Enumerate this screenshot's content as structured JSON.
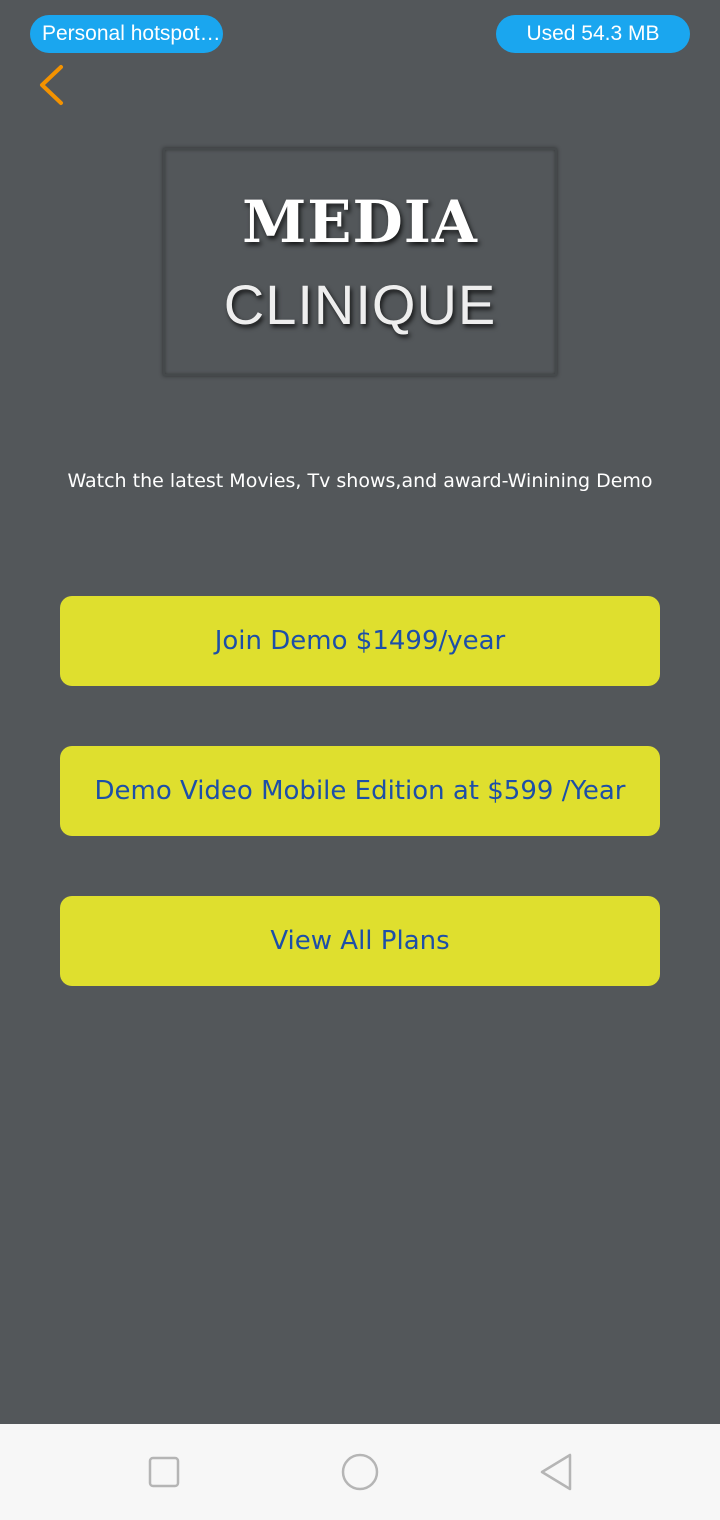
{
  "status_bar": {
    "hotspot_label": "Personal hotspot…",
    "data_used_label": "Used  54.3 MB"
  },
  "header": {
    "back_icon": "chevron-left-icon",
    "back_color": "#f39200"
  },
  "logo": {
    "line1": "MEDIA",
    "line2": "CLINIQUE"
  },
  "tagline": "Watch the latest Movies, Tv shows,and award-Winining Demo",
  "actions": {
    "join": "Join Demo $1499/year",
    "mobile": "Demo Video Mobile Edition at $599 /Year",
    "plans": "View All Plans"
  },
  "nav_bar": {
    "recent_icon": "square-icon",
    "home_icon": "circle-icon",
    "back_icon": "triangle-back-icon"
  },
  "colors": {
    "background": "#53575a",
    "button_bg": "#dfdf2e",
    "button_text": "#1d4fa8",
    "pill_bg": "#1aa6ef"
  }
}
